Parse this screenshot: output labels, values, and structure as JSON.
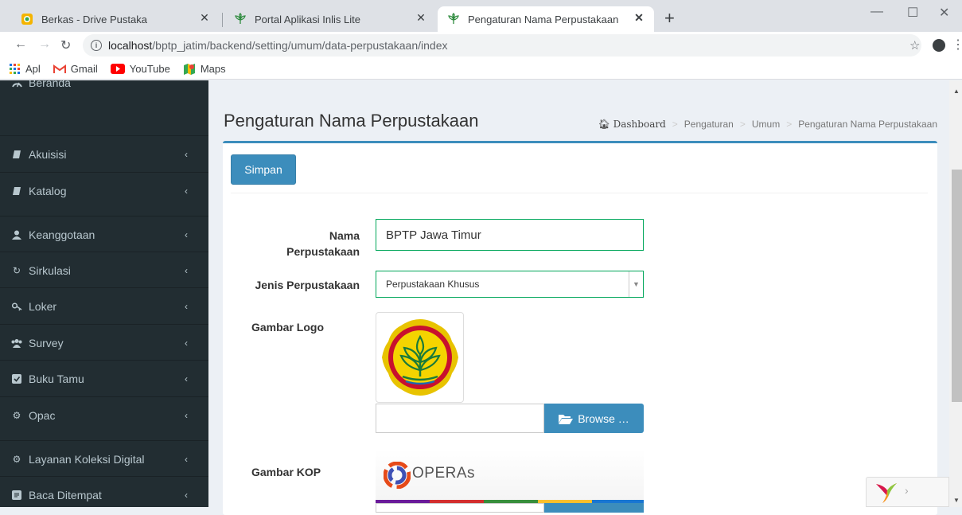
{
  "browser": {
    "tabs": [
      {
        "title": "Berkas - Drive Pustaka",
        "active": false,
        "favicon": "drive-icon"
      },
      {
        "title": "Portal Aplikasi Inlis Lite",
        "active": false,
        "favicon": "inlis-icon"
      },
      {
        "title": "Pengaturan Nama Perpustakaan",
        "active": true,
        "favicon": "inlis-icon"
      }
    ],
    "url_host": "localhost",
    "url_path": "/bptp_jatim/backend/setting/umum/data-perpustakaan/index",
    "bookmarks": [
      {
        "label": "Apl",
        "icon": "apps-grid-icon"
      },
      {
        "label": "Gmail",
        "icon": "gmail-icon"
      },
      {
        "label": "YouTube",
        "icon": "youtube-icon"
      },
      {
        "label": "Maps",
        "icon": "maps-icon"
      }
    ]
  },
  "sidebar": {
    "items": [
      {
        "label": "Beranda",
        "icon": "dashboard-icon",
        "chevron": false
      },
      {
        "label": "Akuisisi",
        "icon": "book-icon",
        "chevron": true
      },
      {
        "label": "Katalog",
        "icon": "book-icon",
        "chevron": true
      },
      {
        "label": "Keanggotaan",
        "icon": "user-icon",
        "chevron": true
      },
      {
        "label": "Sirkulasi",
        "icon": "refresh-icon",
        "chevron": true
      },
      {
        "label": "Loker",
        "icon": "key-icon",
        "chevron": true
      },
      {
        "label": "Survey",
        "icon": "users-icon",
        "chevron": true
      },
      {
        "label": "Buku Tamu",
        "icon": "checkbox-icon",
        "chevron": true
      },
      {
        "label": "Opac",
        "icon": "cogs-icon",
        "chevron": true
      },
      {
        "label": "Layanan Koleksi Digital",
        "icon": "cogs-icon",
        "chevron": true
      },
      {
        "label": "Baca Ditempat",
        "icon": "list-icon",
        "chevron": true
      }
    ]
  },
  "header": {
    "title": "Pengaturan Nama Perpustakaan",
    "breadcrumb": [
      "Dashboard",
      "Pengaturan",
      "Umum",
      "Pengaturan Nama Perpustakaan"
    ]
  },
  "form": {
    "save_label": "Simpan",
    "nama_label_line1": "Nama",
    "nama_label_line2": "Perpustakaan",
    "nama_value": "BPTP Jawa Timur",
    "jenis_label": "Jenis Perpustakaan",
    "jenis_value": "Perpustakaan Khusus",
    "logo_label": "Gambar Logo",
    "browse_label": "Browse …",
    "kop_label": "Gambar KOP",
    "kop_text": "OPERAs"
  },
  "colors": {
    "sidebar_bg": "#222d32",
    "primary": "#3c8dbc",
    "input_border": "#00a65a",
    "content_bg": "#ecf0f5"
  }
}
